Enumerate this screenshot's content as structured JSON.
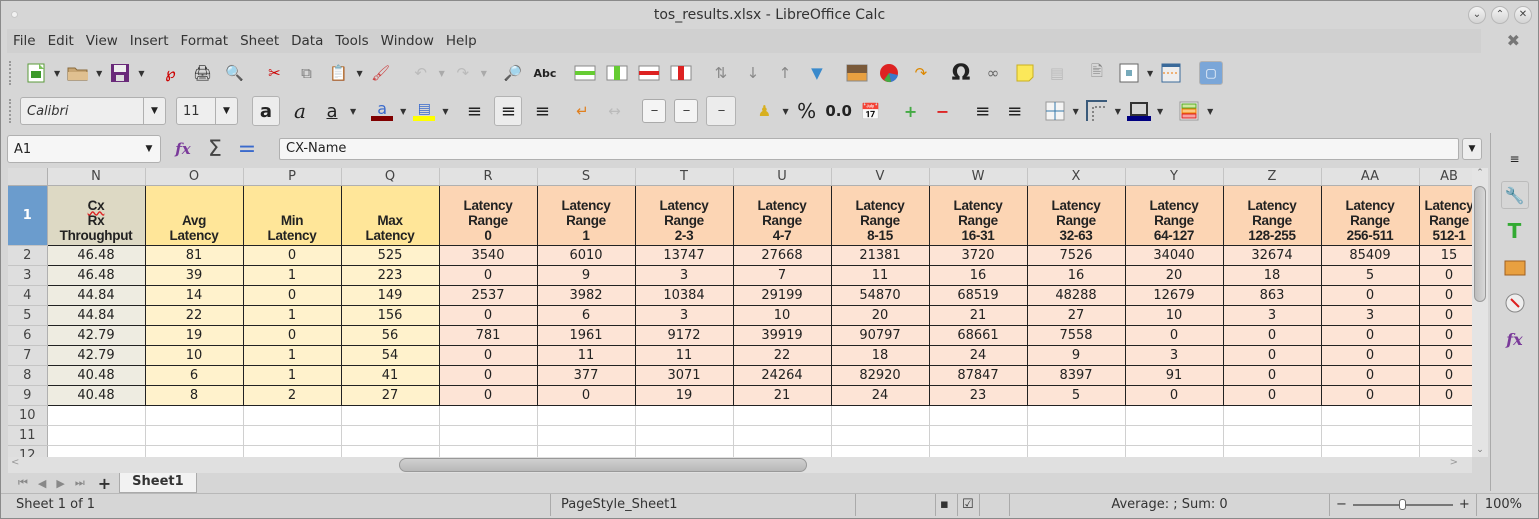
{
  "window": {
    "title": "tos_results.xlsx - LibreOffice Calc"
  },
  "menu": [
    "File",
    "Edit",
    "View",
    "Insert",
    "Format",
    "Sheet",
    "Data",
    "Tools",
    "Window",
    "Help"
  ],
  "toolbar_standard": [
    "new-spreadsheet",
    "open",
    "save",
    "export-pdf",
    "print",
    "print-preview",
    "cut",
    "copy",
    "paste",
    "clone-formatting",
    "undo",
    "redo",
    "find-replace",
    "spelling",
    "insert-row",
    "insert-column",
    "delete-row",
    "delete-column",
    "sort",
    "sort-ascending",
    "sort-descending",
    "autofilter",
    "insert-image",
    "insert-chart",
    "pivot-table",
    "special-character",
    "hyperlink",
    "comment",
    "headers-footers",
    "define-print-area",
    "freeze-rows-columns",
    "split-window",
    "show-draw-functions"
  ],
  "format": {
    "font_name": "Calibri",
    "font_size": "11",
    "font_color": "#800000",
    "highlight_color": "#ffff00",
    "border_color": "#000080",
    "percent_label": "%",
    "number_label": "0.0"
  },
  "formula": {
    "cell_ref": "A1",
    "content": "CX-Name"
  },
  "columns": [
    "N",
    "O",
    "P",
    "Q",
    "R",
    "S",
    "T",
    "U",
    "V",
    "W",
    "X",
    "Y",
    "Z",
    "AA",
    "AB"
  ],
  "header_row": {
    "row_num": "1",
    "cells": [
      [
        "Cx",
        "Rx",
        "Throughput"
      ],
      [
        "Avg",
        "Latency"
      ],
      [
        "Min",
        "Latency"
      ],
      [
        "Max",
        "Latency"
      ],
      [
        "Latency",
        "Range",
        "0"
      ],
      [
        "Latency",
        "Range",
        "1"
      ],
      [
        "Latency",
        "Range",
        "2-3"
      ],
      [
        "Latency",
        "Range",
        "4-7"
      ],
      [
        "Latency",
        "Range",
        "8-15"
      ],
      [
        "Latency",
        "Range",
        "16-31"
      ],
      [
        "Latency",
        "Range",
        "32-63"
      ],
      [
        "Latency",
        "Range",
        "64-127"
      ],
      [
        "Latency",
        "Range",
        "128-255"
      ],
      [
        "Latency",
        "Range",
        "256-511"
      ],
      [
        "Latency",
        "Range",
        "512-1"
      ]
    ]
  },
  "rows": [
    {
      "num": "2",
      "cells": [
        "46.48",
        "81",
        "0",
        "525",
        "3540",
        "6010",
        "13747",
        "27668",
        "21381",
        "3720",
        "7526",
        "34040",
        "32674",
        "85409",
        "15"
      ]
    },
    {
      "num": "3",
      "cells": [
        "46.48",
        "39",
        "1",
        "223",
        "0",
        "9",
        "3",
        "7",
        "11",
        "16",
        "16",
        "20",
        "18",
        "5",
        "0"
      ]
    },
    {
      "num": "4",
      "cells": [
        "44.84",
        "14",
        "0",
        "149",
        "2537",
        "3982",
        "10384",
        "29199",
        "54870",
        "68519",
        "48288",
        "12679",
        "863",
        "0",
        "0"
      ]
    },
    {
      "num": "5",
      "cells": [
        "44.84",
        "22",
        "1",
        "156",
        "0",
        "6",
        "3",
        "10",
        "20",
        "21",
        "27",
        "10",
        "3",
        "3",
        "0"
      ]
    },
    {
      "num": "6",
      "cells": [
        "42.79",
        "19",
        "0",
        "56",
        "781",
        "1961",
        "9172",
        "39919",
        "90797",
        "68661",
        "7558",
        "0",
        "0",
        "0",
        "0"
      ]
    },
    {
      "num": "7",
      "cells": [
        "42.79",
        "10",
        "1",
        "54",
        "0",
        "11",
        "11",
        "22",
        "18",
        "24",
        "9",
        "3",
        "0",
        "0",
        "0"
      ]
    },
    {
      "num": "8",
      "cells": [
        "40.48",
        "6",
        "1",
        "41",
        "0",
        "377",
        "3071",
        "24264",
        "82920",
        "87847",
        "8397",
        "91",
        "0",
        "0",
        "0"
      ]
    },
    {
      "num": "9",
      "cells": [
        "40.48",
        "8",
        "2",
        "27",
        "0",
        "0",
        "19",
        "21",
        "24",
        "23",
        "5",
        "0",
        "0",
        "0",
        "0"
      ]
    }
  ],
  "empty_rows": [
    "10",
    "11",
    "12"
  ],
  "sheet_tabs": [
    "Sheet1"
  ],
  "status": {
    "sheet": "Sheet 1 of 1",
    "page_style": "PageStyle_Sheet1",
    "summary": "Average: ; Sum: 0",
    "zoom": "100%",
    "zoom_fraction": 0.5
  },
  "sidebar": [
    "properties",
    "styles",
    "gallery",
    "navigator",
    "functions"
  ]
}
